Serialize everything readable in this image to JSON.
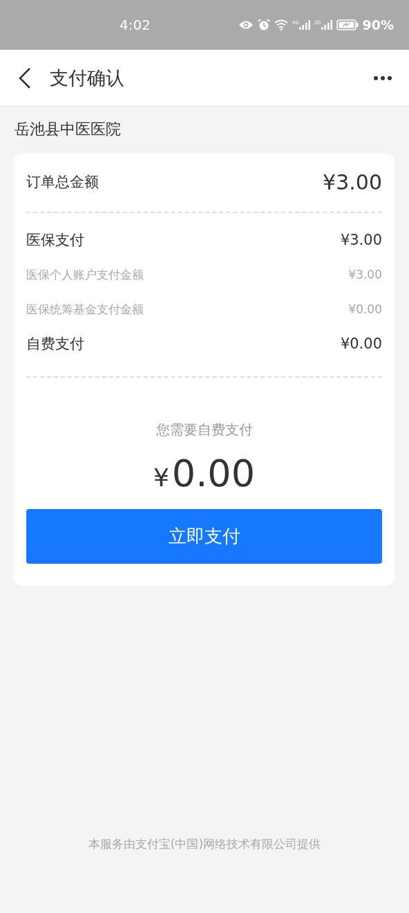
{
  "status_bar": {
    "time": "4:02",
    "sim1": "4G",
    "sim2": "2G",
    "battery": "90%"
  },
  "header": {
    "title": "支付确认"
  },
  "hospital": "岳池县中医医院",
  "order_total": {
    "label": "订单总金额",
    "amount": "¥3.00"
  },
  "breakdown": [
    {
      "kind": "main",
      "label": "医保支付",
      "amount": "¥3.00"
    },
    {
      "kind": "sub",
      "label": "医保个人账户支付金额",
      "amount": "¥3.00"
    },
    {
      "kind": "sub",
      "label": "医保统筹基金支付金额",
      "amount": "¥0.00"
    },
    {
      "kind": "main",
      "label": "自费支付",
      "amount": "¥0.00"
    }
  ],
  "due": {
    "prompt": "您需要自费支付",
    "currency": "¥",
    "amount": "0.00"
  },
  "pay_button": "立即支付",
  "footer": "本服务由支付宝(中国)网络技术有限公司提供"
}
